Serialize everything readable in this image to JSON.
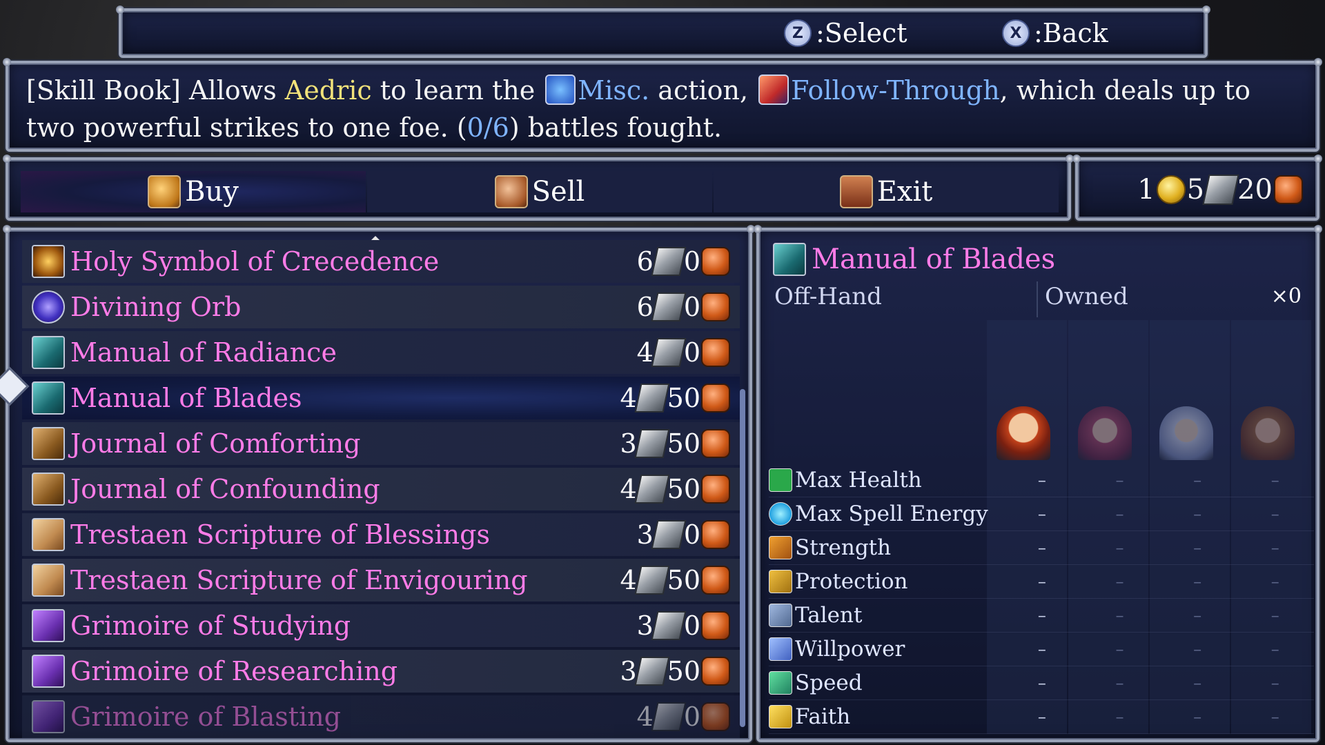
{
  "controls": {
    "select_key": "Z",
    "select_label": ":Select",
    "back_key": "X",
    "back_label": ":Back"
  },
  "description": {
    "prefix": "[Skill Book] Allows ",
    "character": "Aedric",
    "mid1": " to learn the ",
    "action_type": "Misc.",
    "mid2": " action, ",
    "skill_name": "Follow-Through",
    "mid3": ", which deals up to two powerful strikes to one foe. (",
    "progress": "0/6",
    "suffix": ") battles fought."
  },
  "menu": {
    "buy": "Buy",
    "sell": "Sell",
    "exit": "Exit"
  },
  "currency": {
    "gold": "1",
    "silver": "5",
    "copper": "20"
  },
  "items": [
    {
      "name": "Holy Symbol of Crecedence",
      "icon": "holy-symbol-icon",
      "silver": "6",
      "copper": "0"
    },
    {
      "name": "Divining Orb",
      "icon": "orb-icon",
      "silver": "6",
      "copper": "0"
    },
    {
      "name": "Manual of Radiance",
      "icon": "manual-icon",
      "silver": "4",
      "copper": "0"
    },
    {
      "name": "Manual of Blades",
      "icon": "manual-icon",
      "silver": "4",
      "copper": "50"
    },
    {
      "name": "Journal of Comforting",
      "icon": "journal-icon",
      "silver": "3",
      "copper": "50"
    },
    {
      "name": "Journal of Confounding",
      "icon": "journal-icon",
      "silver": "4",
      "copper": "50"
    },
    {
      "name": "Trestaen Scripture of Blessings",
      "icon": "scripture-icon",
      "silver": "3",
      "copper": "0"
    },
    {
      "name": "Trestaen Scripture of Envigouring",
      "icon": "scripture-icon",
      "silver": "4",
      "copper": "50"
    },
    {
      "name": "Grimoire of Studying",
      "icon": "grimoire-icon",
      "silver": "3",
      "copper": "0"
    },
    {
      "name": "Grimoire of Researching",
      "icon": "grimoire-icon",
      "silver": "3",
      "copper": "50"
    },
    {
      "name": "Grimoire of Blasting",
      "icon": "grimoire-icon",
      "silver": "4",
      "copper": "0"
    }
  ],
  "selected_item": "Manual of Blades",
  "detail": {
    "title": "Manual of Blades",
    "slot": "Off-Hand",
    "owned_label": "Owned",
    "owned_count": "×0",
    "stats": [
      {
        "name": "Max Health",
        "icon": "health-icon",
        "values": [
          "–",
          "–",
          "–",
          "–"
        ]
      },
      {
        "name": "Max Spell Energy",
        "icon": "spell-energy-icon",
        "values": [
          "–",
          "–",
          "–",
          "–"
        ]
      },
      {
        "name": "Strength",
        "icon": "strength-icon",
        "values": [
          "–",
          "–",
          "–",
          "–"
        ]
      },
      {
        "name": "Protection",
        "icon": "protection-icon",
        "values": [
          "–",
          "–",
          "–",
          "–"
        ]
      },
      {
        "name": "Talent",
        "icon": "talent-icon",
        "values": [
          "–",
          "–",
          "–",
          "–"
        ]
      },
      {
        "name": "Willpower",
        "icon": "willpower-icon",
        "values": [
          "–",
          "–",
          "–",
          "–"
        ]
      },
      {
        "name": "Speed",
        "icon": "speed-icon",
        "values": [
          "–",
          "–",
          "–",
          "–"
        ]
      },
      {
        "name": "Faith",
        "icon": "faith-icon",
        "values": [
          "–",
          "–",
          "–",
          "–"
        ]
      }
    ]
  }
}
